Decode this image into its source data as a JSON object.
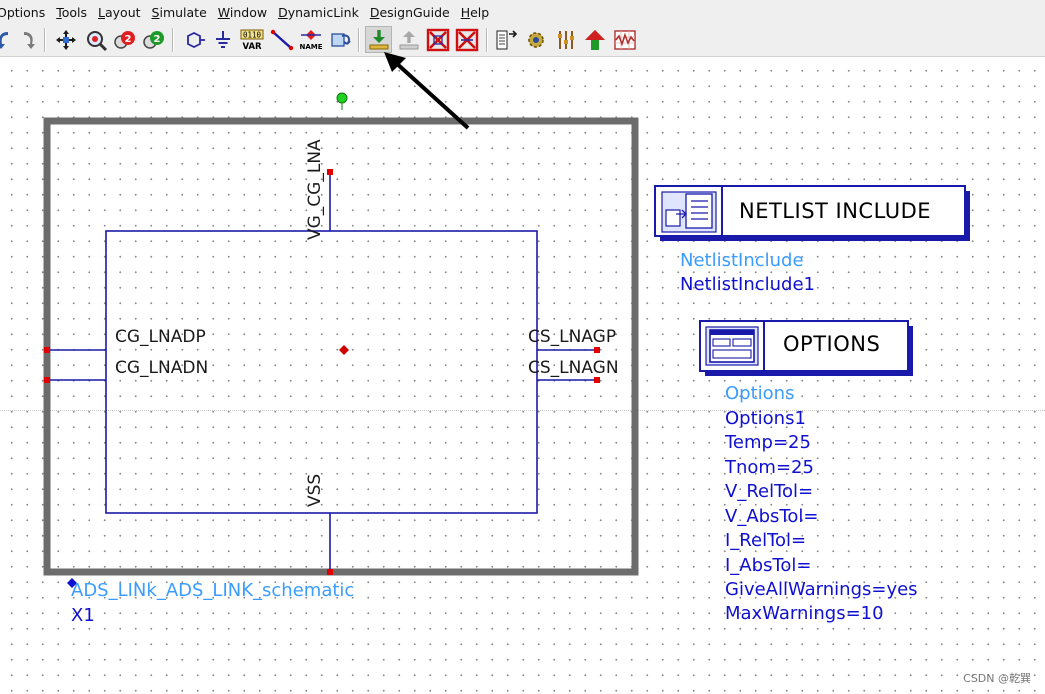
{
  "menu": [
    "Options",
    "Tools",
    "Layout",
    "Simulate",
    "Window",
    "DynamicLink",
    "DesignGuide",
    "Help"
  ],
  "toolbar": {
    "icons": [
      "redo-icon",
      "move-icon",
      "zoom-icon",
      "push-into-icon",
      "pop-out-icon",
      "port-icon",
      "ground-icon",
      "var-icon",
      "wire-icon",
      "name-icon",
      "update-icon",
      "push-down-icon",
      "pop-up-icon",
      "deactivate-icon",
      "short-icon",
      "netlist-icon",
      "options-gear-icon",
      "tuning-icon",
      "optimize-icon",
      "waveform-icon"
    ],
    "var_label": "VAR",
    "var_bits": "0110",
    "name_label": "NAME"
  },
  "schematic": {
    "pins": {
      "top": "VG_CG_LNA",
      "left_top": "CG_LNADP",
      "left_bottom": "CG_LNADN",
      "right_top": "CS_LNAGP",
      "right_bottom": "CS_LNAGN",
      "bottom": "VSS"
    },
    "instance_lines": [
      "ADS_LINk_ADS_LINK_schematic",
      "X1"
    ]
  },
  "netlist_include": {
    "title": "NETLIST  INCLUDE",
    "lines": [
      "NetlistInclude",
      "NetlistInclude1"
    ]
  },
  "options": {
    "title": "OPTIONS",
    "lines": [
      "Options",
      "Options1",
      "Temp=25",
      "Tnom=25",
      "V_RelTol=",
      "V_AbsTol=",
      "I_RelTol=",
      "I_AbsTol=",
      "GiveAllWarnings=yes",
      "MaxWarnings=10"
    ]
  },
  "watermark": "CSDN @乾巽",
  "colors": {
    "wire": "#1a1aaa",
    "symbol_border": "#6c6c6c",
    "pin_marker": "#e00000",
    "param_blue": "#3a9cff",
    "param_darkblue": "#1010d0"
  }
}
